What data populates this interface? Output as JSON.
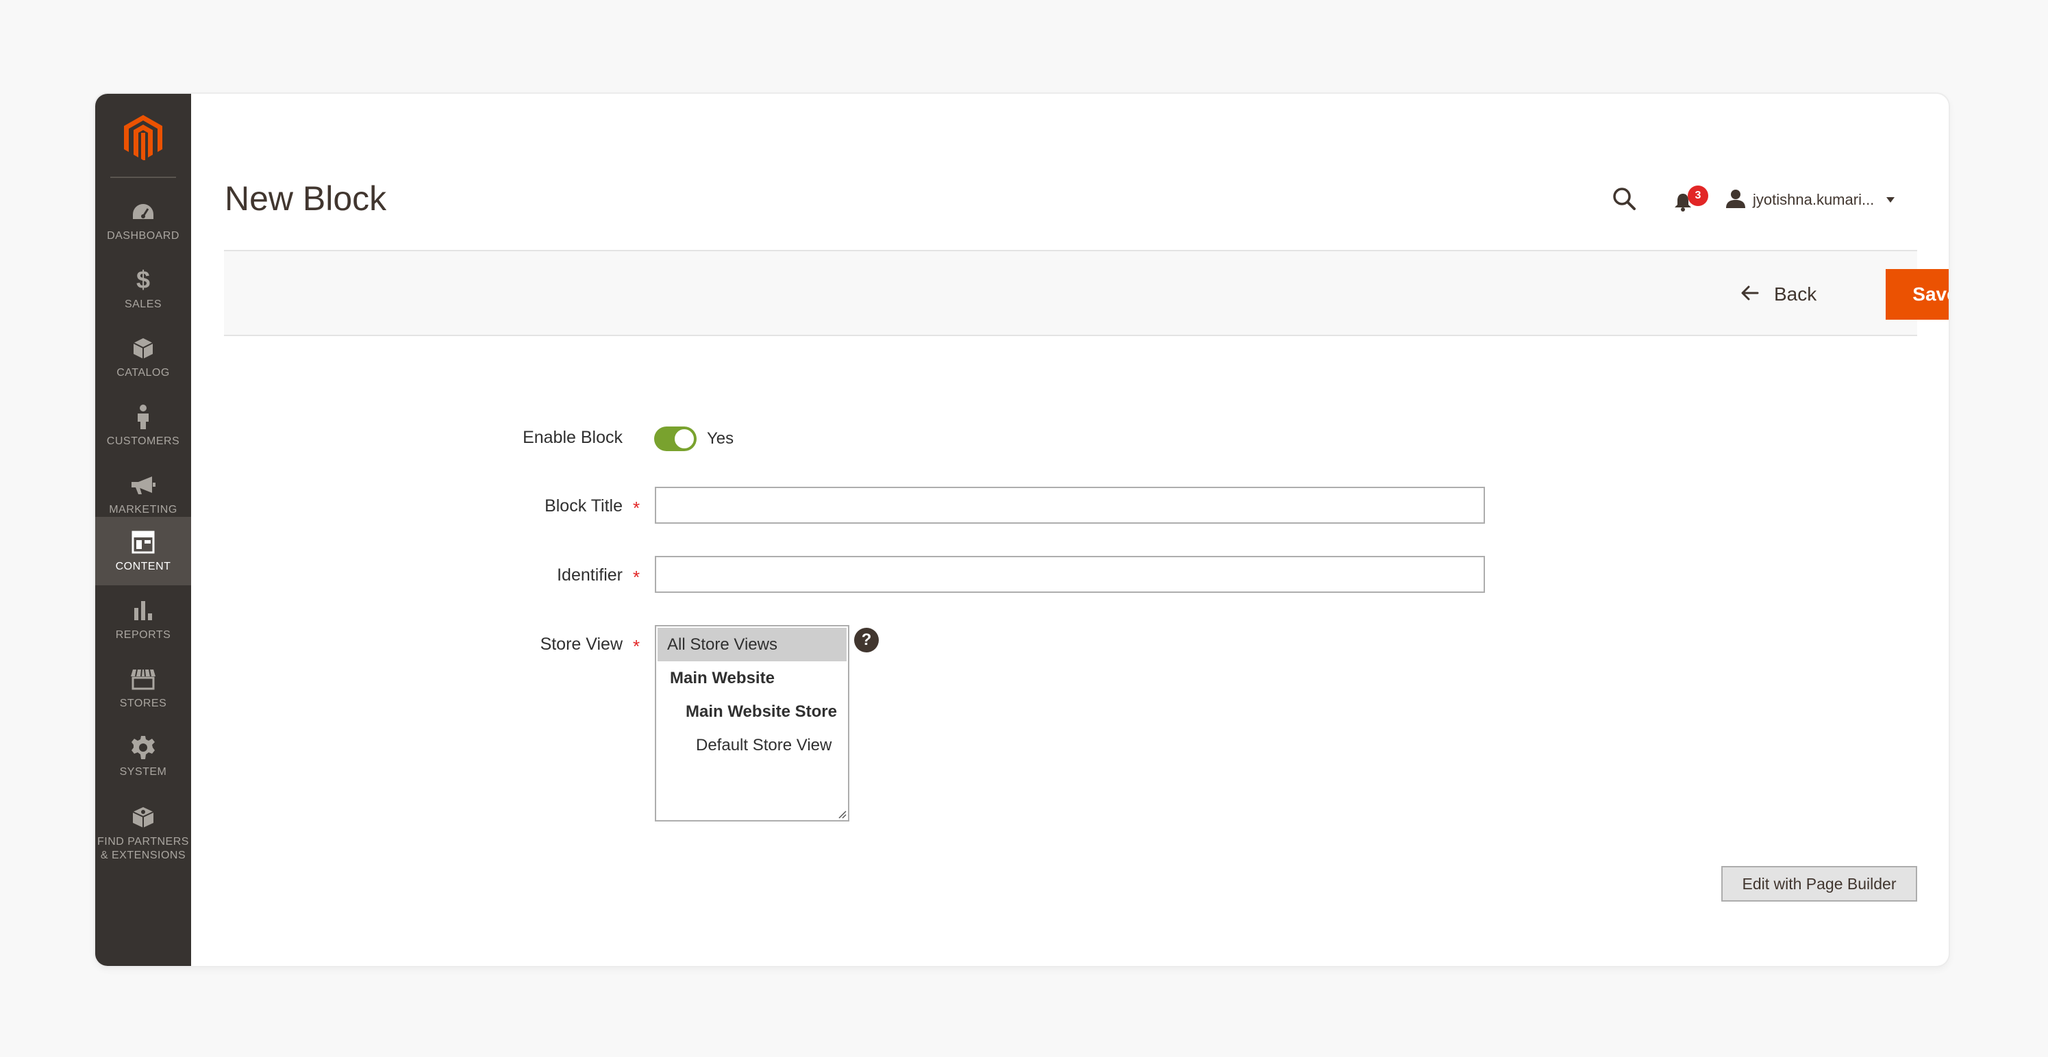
{
  "sidebar": {
    "logo_icon": "magento-logo-icon",
    "items": [
      {
        "label": "DASHBOARD",
        "icon": "dashboard-gauge-icon",
        "active": false
      },
      {
        "label": "SALES",
        "icon": "dollar-icon",
        "active": false
      },
      {
        "label": "CATALOG",
        "icon": "box-icon",
        "active": false
      },
      {
        "label": "CUSTOMERS",
        "icon": "person-icon",
        "active": false
      },
      {
        "label": "MARKETING",
        "icon": "megaphone-icon",
        "active": false
      },
      {
        "label": "CONTENT",
        "icon": "layout-icon",
        "active": true
      },
      {
        "label": "REPORTS",
        "icon": "bar-chart-icon",
        "active": false
      },
      {
        "label": "STORES",
        "icon": "storefront-icon",
        "active": false
      },
      {
        "label": "SYSTEM",
        "icon": "gear-icon",
        "active": false
      },
      {
        "label_line1": "FIND PARTNERS",
        "label_line2": "& EXTENSIONS",
        "icon": "extensions-box-icon",
        "active": false
      }
    ]
  },
  "header": {
    "title": "New Block",
    "notifications_count": "3",
    "user_name": "jyotishna.kumari..."
  },
  "actions": {
    "back_label": "Back",
    "save_label": "Save"
  },
  "form": {
    "enable_label": "Enable Block",
    "enable_value": "Yes",
    "title_label": "Block Title",
    "title_value": "",
    "identifier_label": "Identifier",
    "identifier_value": "",
    "store_view_label": "Store View",
    "required_mark": "*",
    "store_options": [
      {
        "label": "All Store Views",
        "selected": true
      },
      {
        "label": "Main Website"
      },
      {
        "label": "Main Website Store"
      },
      {
        "label": "Default Store View"
      }
    ],
    "help_glyph": "?"
  },
  "page_builder_label": "Edit with Page Builder",
  "colors": {
    "sidebar_bg": "#373330",
    "sidebar_active": "#524d49",
    "accent_orange": "#eb5202",
    "toggle_green": "#79a22e",
    "badge_red": "#e22626"
  }
}
